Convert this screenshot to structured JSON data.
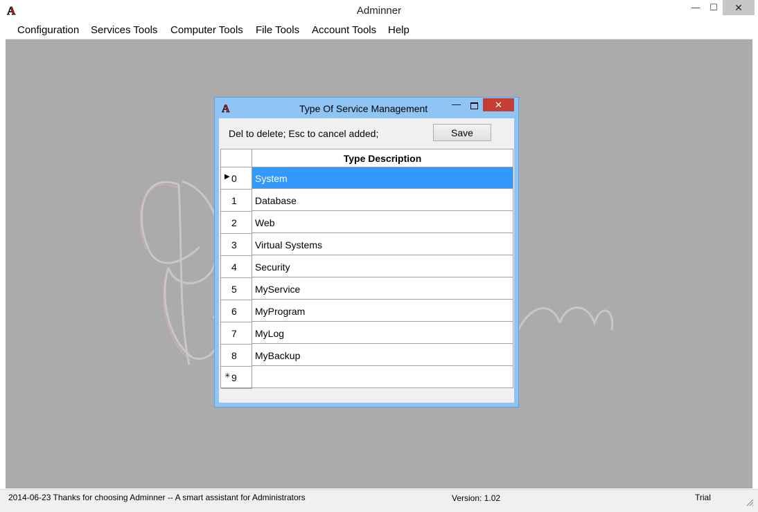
{
  "window": {
    "title": "Adminner",
    "minimize": "—",
    "maximize": "☐",
    "close": "✕"
  },
  "menu": [
    "Configuration",
    "Services Tools",
    "Computer Tools",
    "File Tools",
    "Account Tools",
    "Help"
  ],
  "dialog": {
    "title": "Type Of Service Management",
    "minimize": "—",
    "close": "✕",
    "hint": "Del to delete; Esc to cancel added;",
    "save_label": "Save",
    "column_header": "Type Description",
    "rows": [
      {
        "num": "0",
        "desc": "System",
        "selected": true,
        "marker": "▶"
      },
      {
        "num": "1",
        "desc": "Database"
      },
      {
        "num": "2",
        "desc": "Web"
      },
      {
        "num": "3",
        "desc": "Virtual Systems"
      },
      {
        "num": "4",
        "desc": "Security"
      },
      {
        "num": "5",
        "desc": "MyService"
      },
      {
        "num": "6",
        "desc": "MyProgram"
      },
      {
        "num": "7",
        "desc": "MyLog"
      },
      {
        "num": "8",
        "desc": "MyBackup"
      },
      {
        "num": "9",
        "desc": "",
        "marker": "✳"
      }
    ]
  },
  "status": {
    "message": "2014-06-23  Thanks for choosing Adminner -- A smart assistant for Administrators",
    "version": "Version: 1.02",
    "license": "Trial"
  },
  "colors": {
    "workspace": "#ababab",
    "dialog_frame": "#8ec5f4",
    "selection": "#3399ff",
    "close_button": "#c63d35"
  }
}
